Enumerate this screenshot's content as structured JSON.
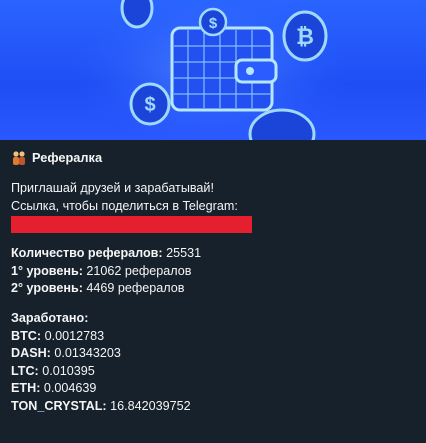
{
  "message": {
    "title": "Рефералка",
    "invite_line": "Приглашай друзей и зарабатывай!",
    "link_label": "Ссылка, чтобы поделиться в Telegram:",
    "link_redacted": true,
    "stats": {
      "total_label": "Количество рефералов:",
      "total_value": " 25531",
      "level1_label": "1° уровень:",
      "level1_value": " 21062 рефералов",
      "level2_label": "2° уровень:",
      "level2_value": " 4469 рефералов"
    },
    "earnings": {
      "header": "Заработано:",
      "rows": [
        {
          "label": "BTC:",
          "value": " 0.0012783"
        },
        {
          "label": "DASH:",
          "value": " 0.01343203"
        },
        {
          "label": "LTC:",
          "value": " 0.010395"
        },
        {
          "label": "ETH:",
          "value": " 0.004639"
        },
        {
          "label": "TON_CRYSTAL:",
          "value": " 16.842039752"
        }
      ]
    }
  },
  "colors": {
    "background": "#17212b",
    "banner_blue": "#2a64ff",
    "redaction_red": "#e51f2e",
    "text": "#f5f5f5"
  },
  "icons": [
    "referral-people-emoji-icon",
    "wallet-icon",
    "dollar-coin-icon",
    "bitcoin-coin-icon"
  ]
}
